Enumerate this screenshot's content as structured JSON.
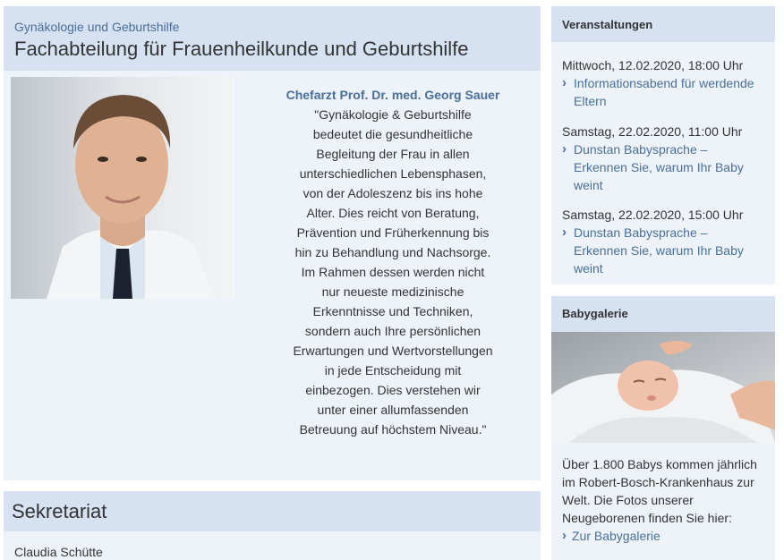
{
  "main": {
    "subtitle": "Gynäkologie und Geburtshilfe",
    "title": "Fachabteilung für Frauenheilkunde und Geburtshilfe",
    "quote_name": "Chefarzt Prof. Dr. med. Georg Sauer",
    "quote_lines": [
      "\"Gynäkologie & Geburtshilfe",
      "bedeutet die gesundheitliche",
      "Begleitung der Frau in allen",
      "unterschiedlichen Lebensphasen,",
      "von der Adoleszenz bis ins hohe",
      "Alter. Dies reicht von Beratung,",
      "Prävention und Früherkennung bis",
      "hin zu Behandlung und Nachsorge.",
      "Im Rahmen dessen werden nicht",
      "nur neueste medizinische",
      "Erkenntnisse und Techniken,",
      "sondern auch Ihre persönlichen",
      "Erwartungen und Wertvorstellungen",
      "in jede Entscheidung mit",
      "einbezogen. Dies verstehen wir",
      "unter einer allumfassenden",
      "Betreuung auf höchstem Niveau.\""
    ]
  },
  "sekretariat": {
    "title": "Sekretariat",
    "person": "Claudia Schütte"
  },
  "events": {
    "title": "Veranstaltungen",
    "items": [
      {
        "date": "Mittwoch, 12.02.2020, 18:00 Uhr",
        "link_lines": [
          "Informationsabend für werdende",
          "Eltern"
        ],
        "highlighted": true
      },
      {
        "date": "Samstag, 22.02.2020, 11:00 Uhr",
        "link_lines": [
          "Dunstan Babysprache –",
          "Erkennen Sie, warum Ihr Baby",
          "weint"
        ],
        "highlighted": false
      },
      {
        "date": "Samstag, 22.02.2020, 15:00 Uhr",
        "link_lines": [
          "Dunstan Babysprache –",
          "Erkennen Sie, warum Ihr Baby",
          "weint"
        ],
        "highlighted": false
      }
    ]
  },
  "gallery": {
    "title": "Babygalerie",
    "text_lines": [
      "Über 1.800 Babys kommen jährlich",
      "im Robert-Bosch-Krankenhaus zur",
      "Welt. Die Fotos unserer",
      "Neugeborenen finden Sie hier:"
    ],
    "link": "Zur Babygalerie"
  },
  "icons": {
    "link_chevron": "chevron-right-icon",
    "highlight_color": "#ffef33"
  },
  "colors": {
    "header_bg": "#d6e2f1",
    "panel_bg": "#eef3f9",
    "link": "#4a6f9c"
  }
}
